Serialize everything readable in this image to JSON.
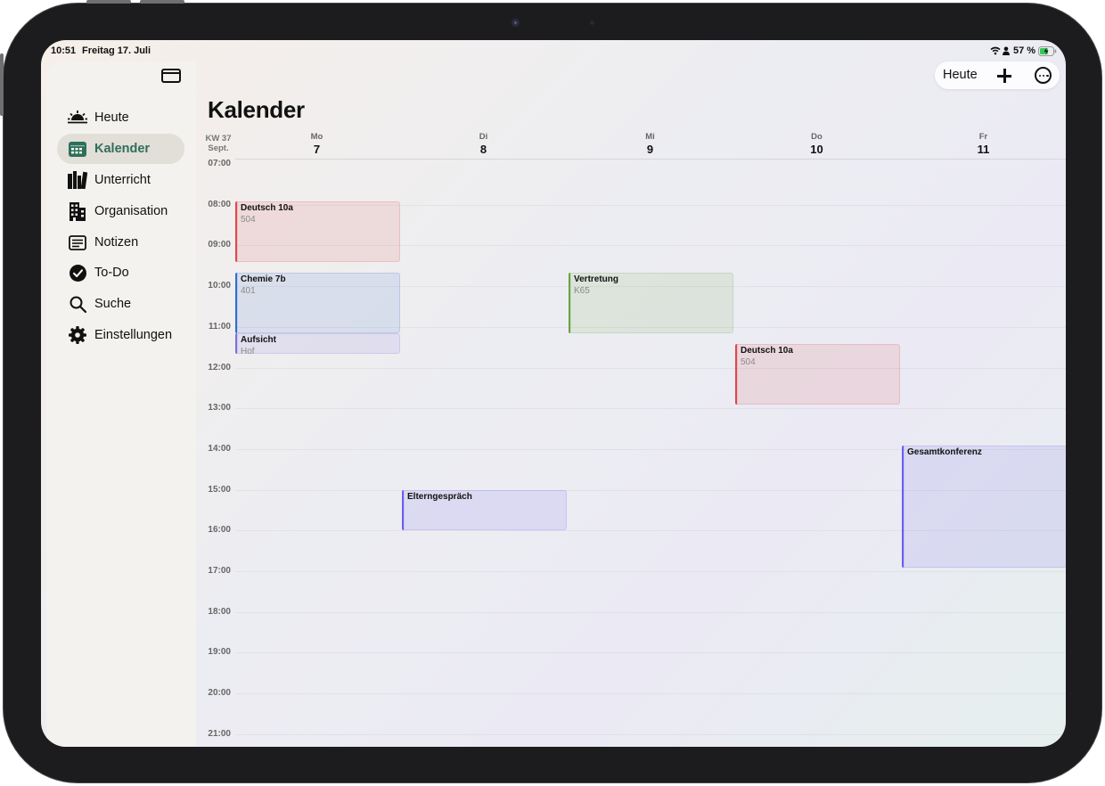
{
  "status": {
    "time": "10:51",
    "date": "Freitag 17. Juli",
    "battery": "57 %"
  },
  "sidebar": {
    "items": [
      {
        "label": "Heute",
        "icon": "sunrise-icon"
      },
      {
        "label": "Kalender",
        "icon": "calendar-icon",
        "active": true
      },
      {
        "label": "Unterricht",
        "icon": "books-icon"
      },
      {
        "label": "Organisation",
        "icon": "building-icon"
      },
      {
        "label": "Notizen",
        "icon": "notes-icon"
      },
      {
        "label": "To-Do",
        "icon": "checkmark-circle-icon"
      },
      {
        "label": "Suche",
        "icon": "search-icon"
      },
      {
        "label": "Einstellungen",
        "icon": "gear-icon"
      }
    ]
  },
  "page": {
    "title": "Kalender"
  },
  "toolbar": {
    "today_label": "Heute"
  },
  "week": {
    "kw": "KW 37",
    "month": "Sept.",
    "days": [
      {
        "name": "Mo",
        "num": "7"
      },
      {
        "name": "Di",
        "num": "8"
      },
      {
        "name": "Mi",
        "num": "9"
      },
      {
        "name": "Do",
        "num": "10"
      },
      {
        "name": "Fr",
        "num": "11"
      }
    ]
  },
  "hours": [
    "07:00",
    "08:00",
    "09:00",
    "10:00",
    "11:00",
    "12:00",
    "13:00",
    "14:00",
    "15:00",
    "16:00",
    "17:00",
    "18:00",
    "19:00",
    "20:00",
    "21:00"
  ],
  "events": [
    {
      "title": "Deutsch 10a",
      "room": "504",
      "day": 0,
      "start": "07:55",
      "end": "09:25",
      "color": "#e0474c"
    },
    {
      "title": "Chemie 7b",
      "room": "401",
      "day": 0,
      "start": "09:40",
      "end": "11:10",
      "color": "#2f6fd0"
    },
    {
      "title": "Aufsicht",
      "room": "Hof",
      "day": 0,
      "start": "11:10",
      "end": "11:40",
      "color": "#7b6fe0"
    },
    {
      "title": "Vertretung",
      "room": "K65",
      "day": 2,
      "start": "09:40",
      "end": "11:10",
      "color": "#6aa343"
    },
    {
      "title": "Deutsch 10a",
      "room": "504",
      "day": 3,
      "start": "11:25",
      "end": "12:55",
      "color": "#e0474c"
    },
    {
      "title": "Elterngespräch",
      "room": "",
      "day": 1,
      "start": "15:00",
      "end": "16:00",
      "color": "#6b5ef0"
    },
    {
      "title": "Gesamtkonferenz",
      "room": "",
      "day": 4,
      "start": "13:55",
      "end": "16:55",
      "color": "#6b5ef0"
    }
  ]
}
